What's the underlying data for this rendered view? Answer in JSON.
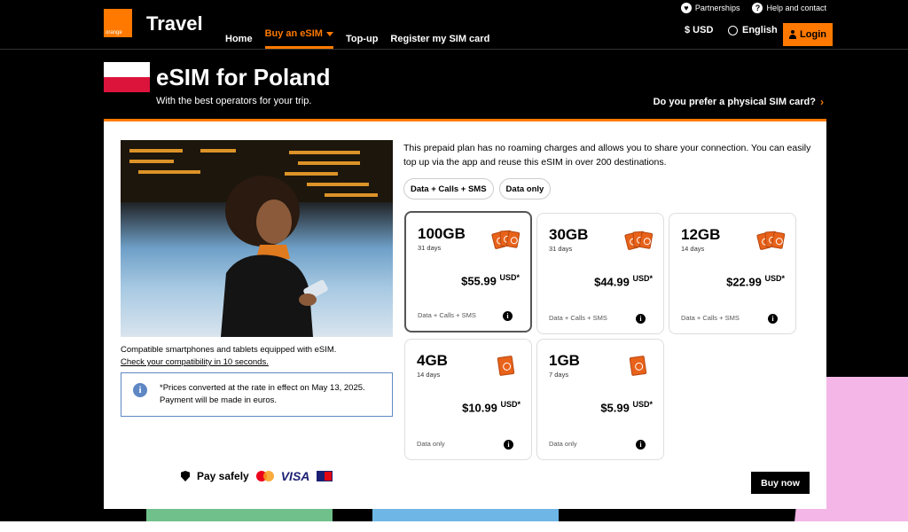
{
  "header": {
    "logo_text": "orange",
    "brand": "Travel",
    "nav": [
      {
        "label": "Home"
      },
      {
        "label": "Buy an eSIM"
      },
      {
        "label": "Top-up"
      },
      {
        "label": "Register my SIM card"
      }
    ],
    "partnerships": "Partnerships",
    "help": "Help and contact",
    "currency": "$ USD",
    "language": "English",
    "login": "Login",
    "accent": "#ff7900"
  },
  "hero": {
    "title": "eSIM for Poland",
    "subtitle": "With the best operators for your trip.",
    "physical_sim": "Do you prefer a physical SIM card?"
  },
  "left": {
    "compat_text": "Compatible smartphones and tablets equipped with eSIM.",
    "compat_link": "Check your compatibility in 10 seconds.",
    "notice": "*Prices converted at the rate in effect on May 13, 2025. Payment will be made in euros.",
    "pay_safely": "Pay safely",
    "visa": "VISA"
  },
  "main": {
    "description": "This prepaid plan has no roaming charges and allows you to share your connection. You can easily top up via the app and reuse this eSIM in over 200 destinations.",
    "filters": [
      "Data + Calls + SMS",
      "Data only"
    ],
    "plans": [
      {
        "gb": "100GB",
        "days": "31 days",
        "price": "$55.99",
        "currency": "USD*",
        "type": "Data + Calls + SMS"
      },
      {
        "gb": "30GB",
        "days": "31 days",
        "price": "$44.99",
        "currency": "USD*",
        "type": "Data + Calls + SMS"
      },
      {
        "gb": "12GB",
        "days": "14 days",
        "price": "$22.99",
        "currency": "USD*",
        "type": "Data + Calls + SMS"
      },
      {
        "gb": "4GB",
        "days": "14 days",
        "price": "$10.99",
        "currency": "USD*",
        "type": "Data only"
      },
      {
        "gb": "1GB",
        "days": "7 days",
        "price": "$5.99",
        "currency": "USD*",
        "type": "Data only"
      }
    ],
    "buy_now": "Buy now"
  }
}
